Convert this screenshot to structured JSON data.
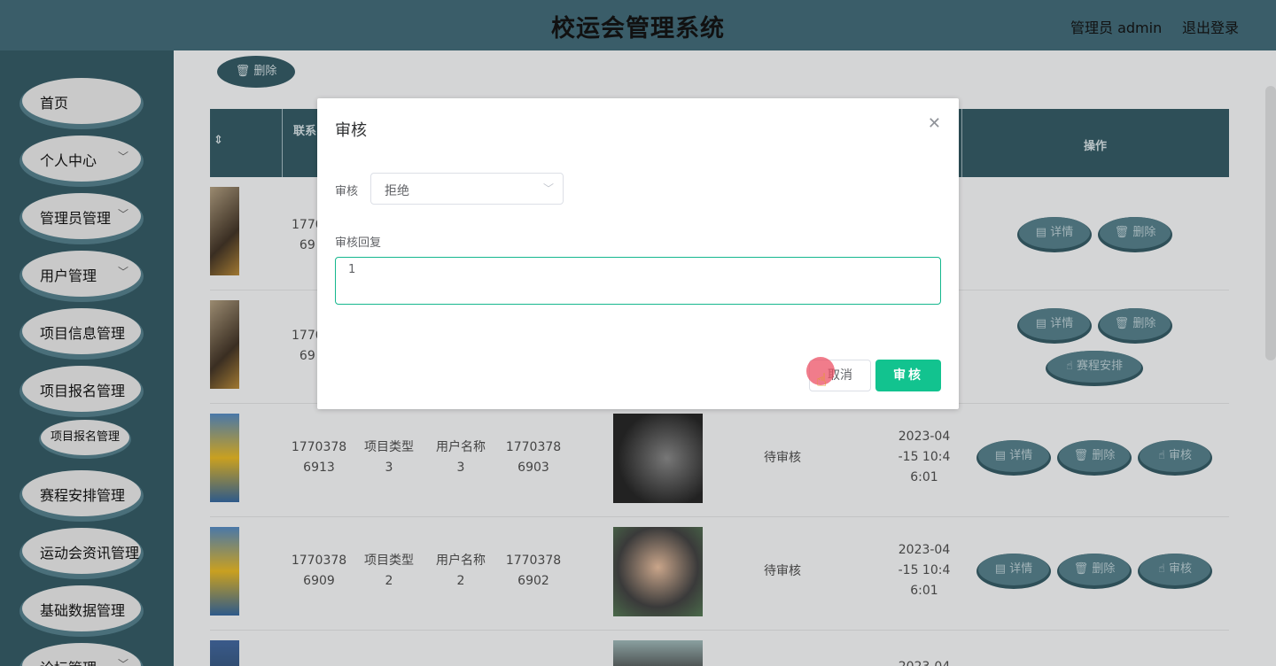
{
  "header": {
    "title": "校运会管理系统",
    "user": "管理员 admin",
    "logout": "退出登录"
  },
  "sidebar": {
    "items": [
      {
        "label": "首页",
        "chevron": false
      },
      {
        "label": "个人中心",
        "chevron": true
      },
      {
        "label": "管理员管理",
        "chevron": true
      },
      {
        "label": "用户管理",
        "chevron": true
      },
      {
        "label": "项目信息管理",
        "chevron": true
      },
      {
        "label": "项目报名管理",
        "chevron": true
      },
      {
        "label": "赛程安排管理",
        "chevron": true
      },
      {
        "label": "运动会资讯管理",
        "chevron": true
      },
      {
        "label": "基础数据管理",
        "chevron": true
      },
      {
        "label": "论坛管理",
        "chevron": true
      }
    ],
    "sub_item": "项目报名管理"
  },
  "main": {
    "delete_button": "删除",
    "headers": {
      "sort_icon": "sort-icon",
      "contact": "联系",
      "ops": "操作"
    },
    "rows": [
      {
        "phone": "1770378 6913",
        "type": "项目类型 3",
        "user": "用户名称 3",
        "phone2": "1770378 6903",
        "status": "待审核",
        "date": "2023-04 -15 10:4 6:01"
      },
      {
        "phone": "1770378 6909",
        "type": "项目类型 2",
        "user": "用户名称 2",
        "phone2": "1770378 6902",
        "status": "待审核",
        "date": "2023-04 -15 10:4 6:01"
      }
    ],
    "partial_rows": [
      {
        "phone_top": "1770",
        "phone_bottom": "69"
      },
      {
        "phone_top": "1770",
        "phone_bottom": "69"
      }
    ],
    "partial_date": "2023-04",
    "ops": {
      "detail": "详情",
      "delete": "删除",
      "schedule": "赛程安排",
      "audit": "审核"
    }
  },
  "dialog": {
    "title": "审核",
    "audit_label": "审核",
    "audit_value": "拒绝",
    "reply_label": "审核回复",
    "reply_value": "1",
    "cancel": "取消",
    "confirm": "审核"
  },
  "colors": {
    "header_bg": "#3a5d69",
    "sidebar_bg": "#2e4f58",
    "table_header_bg": "#2e4f58",
    "confirm_btn": "#12c38f",
    "textarea_border": "#15b78e"
  }
}
